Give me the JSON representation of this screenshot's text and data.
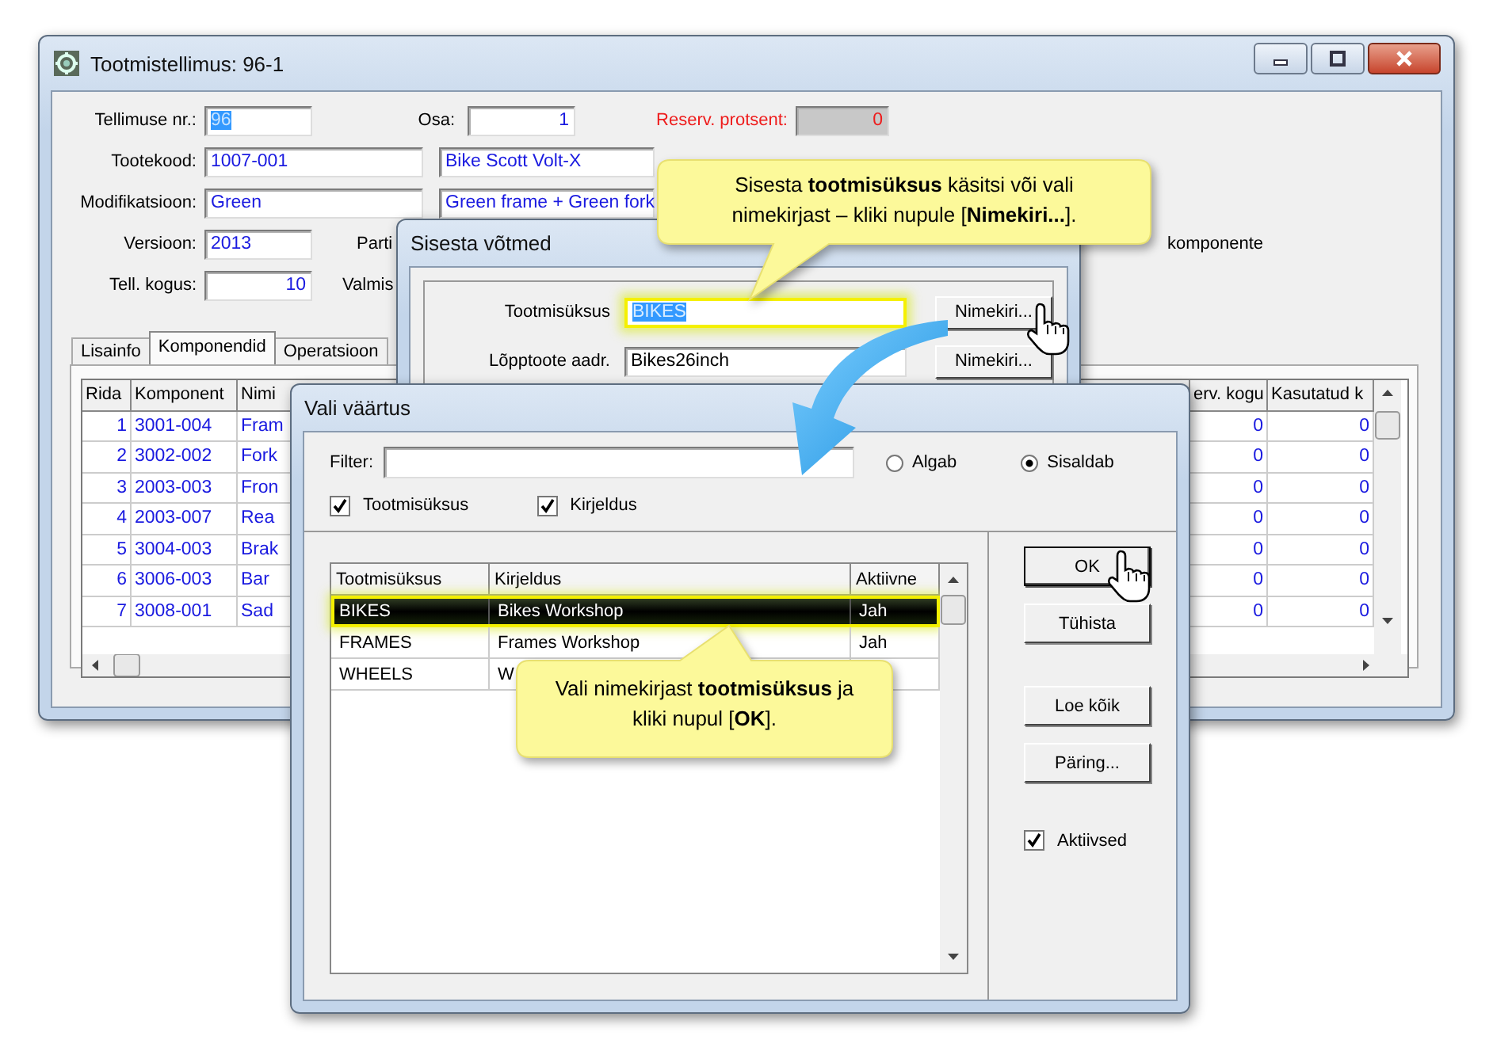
{
  "main_window": {
    "title": "Tootmistellimus: 96-1",
    "form": {
      "order_no": {
        "label": "Tellimuse nr.:",
        "value": "96",
        "text_selected": true
      },
      "part": {
        "label": "Osa:",
        "value": "1"
      },
      "reserve": {
        "label": "Reserv. protsent:",
        "value": "0"
      },
      "product_code": {
        "label": "Tootekood:",
        "value": "1007-001"
      },
      "product_name": {
        "value": "Bike Scott Volt-X"
      },
      "modification": {
        "label": "Modifikatsioon:",
        "value": "Green"
      },
      "modification_name": {
        "value": "Green frame + Green fork"
      },
      "version": {
        "label": "Versioon:",
        "value": "2013"
      },
      "batch_label": "Parti",
      "quantity": {
        "label": "Tell. kogus:",
        "value": "10"
      },
      "done_label": "Valmis",
      "note": "komponente"
    },
    "tabs": [
      {
        "label": "Lisainfo",
        "selected": false
      },
      {
        "label": "Komponendid",
        "selected": true
      },
      {
        "label": "Operatsioon",
        "selected": false
      }
    ],
    "table": {
      "columns": [
        "Rida",
        "Komponent",
        "Nimi",
        "erv. kogu",
        "Kasutatud k"
      ],
      "rows": [
        [
          "1",
          "3001-004",
          "Fram",
          "0",
          "0"
        ],
        [
          "2",
          "3002-002",
          "Fork",
          "0",
          "0"
        ],
        [
          "3",
          "2003-003",
          "Fron",
          "0",
          "0"
        ],
        [
          "4",
          "2003-007",
          "Rea",
          "0",
          "0"
        ],
        [
          "5",
          "3004-003",
          "Brak",
          "0",
          "0"
        ],
        [
          "6",
          "3006-003",
          "Bar",
          "0",
          "0"
        ],
        [
          "7",
          "3008-001",
          "Sad",
          "0",
          "0"
        ]
      ]
    }
  },
  "keys_dialog": {
    "title": "Sisesta võtmed",
    "rows": [
      {
        "label": "Tootmisüksus",
        "value": "BIKES",
        "text_selected": true,
        "highlighted": true,
        "button": "Nimekiri..."
      },
      {
        "label": "Lõpptoote aadr.",
        "value": "Bikes26inch",
        "text_selected": false,
        "highlighted": false,
        "button": "Nimekiri..."
      }
    ]
  },
  "value_dialog": {
    "title": "Vali väärtus",
    "filter": {
      "label": "Filter:"
    },
    "radios": [
      {
        "label": "Algab",
        "selected": false
      },
      {
        "label": "Sisaldab",
        "selected": true
      }
    ],
    "search_in": [
      {
        "label": "Tootmisüksus",
        "checked": true
      },
      {
        "label": "Kirjeldus",
        "checked": true
      }
    ],
    "list": {
      "columns": [
        "Tootmisüksus",
        "Kirjeldus",
        "Aktiivne"
      ],
      "rows": [
        {
          "cells": [
            "BIKES",
            "Bikes Workshop",
            "Jah"
          ],
          "selected": true
        },
        {
          "cells": [
            "FRAMES",
            "Frames Workshop",
            "Jah"
          ],
          "selected": false
        },
        {
          "cells": [
            "WHEELS",
            "W"
          ],
          "selected": false
        }
      ]
    },
    "buttons": [
      {
        "label": "OK",
        "default": true
      },
      {
        "label": "Tühista",
        "default": false
      },
      {
        "label": "Loe kõik",
        "default": false
      },
      {
        "label": "Päring...",
        "default": false
      }
    ],
    "active_only": {
      "label": "Aktiivsed",
      "checked": true
    }
  },
  "callouts": [
    {
      "text": "Sisesta **tootmisüksus** käsitsi või vali nimekirjast – kliki nupule [**Nimekiri...**]."
    },
    {
      "text": "Vali nimekirjast **tootmisüksus** ja kliki nupul [**OK**]."
    }
  ]
}
